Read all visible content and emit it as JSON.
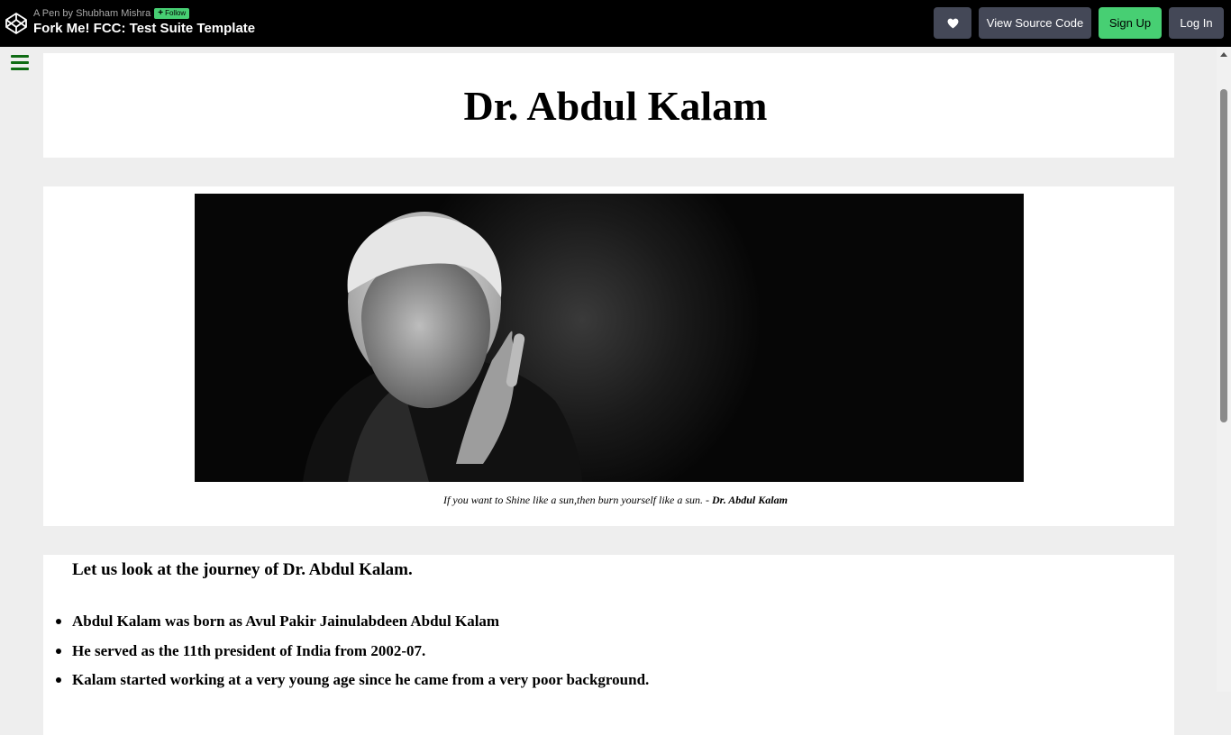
{
  "topbar": {
    "pen_by": "A Pen by Shubham Mishra",
    "follow_label": "Follow",
    "pen_title": "Fork Me! FCC: Test Suite Template",
    "view_source_label": "View Source Code",
    "signup_label": "Sign Up",
    "login_label": "Log In",
    "accent_color": "#47cf73"
  },
  "page": {
    "title": "Dr. Abdul Kalam",
    "quote": "If you want to Shine like a sun,then burn yourself like a sun. - ",
    "quote_author": "Dr. Abdul Kalam",
    "journey_heading": "Let us look at the journey of Dr. Abdul Kalam.",
    "facts": [
      "Abdul Kalam was born as Avul Pakir Jainulabdeen Abdul Kalam",
      "He served as the 11th president of India from 2002-07.",
      "Kalam started working at a very young age since he came from a very poor background."
    ],
    "menu_color": "#0f6b14"
  }
}
